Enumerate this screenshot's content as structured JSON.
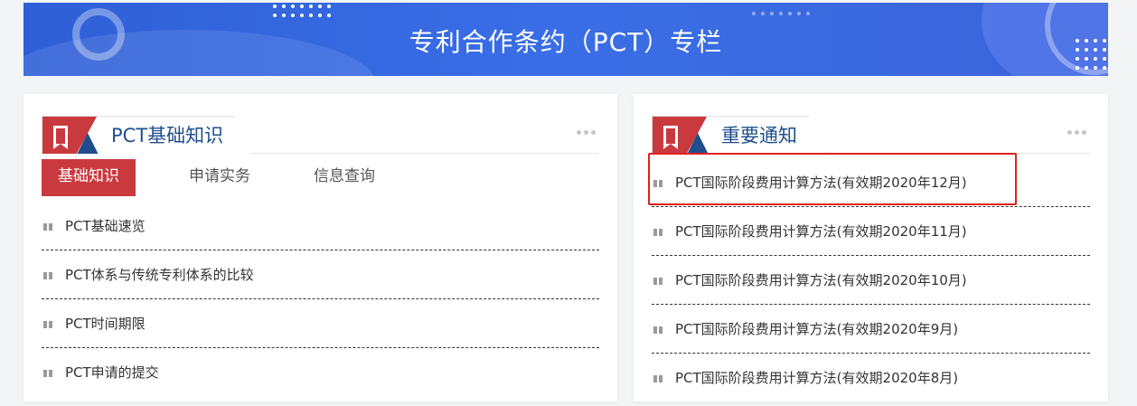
{
  "banner": {
    "title": "专利合作条约（PCT）专栏"
  },
  "left_panel": {
    "title": "PCT基础知识",
    "more_icon": "more-dots-icon",
    "tabs": [
      {
        "label": "基础知识",
        "active": true
      },
      {
        "label": "申请实务",
        "active": false
      },
      {
        "label": "信息查询",
        "active": false
      }
    ],
    "items": [
      {
        "label": "PCT基础速览"
      },
      {
        "label": "PCT体系与传统专利体系的比较"
      },
      {
        "label": "PCT时间期限"
      },
      {
        "label": "PCT申请的提交"
      }
    ]
  },
  "right_panel": {
    "title": "重要通知",
    "more_icon": "more-dots-icon",
    "items": [
      {
        "label": "PCT国际阶段费用计算方法(有效期2020年12月)",
        "highlighted": true
      },
      {
        "label": "PCT国际阶段费用计算方法(有效期2020年11月)"
      },
      {
        "label": "PCT国际阶段费用计算方法(有效期2020年10月)"
      },
      {
        "label": "PCT国际阶段费用计算方法(有效期2020年9月)"
      },
      {
        "label": "PCT国际阶段费用计算方法(有效期2020年8月)"
      }
    ]
  },
  "colors": {
    "banner": "#3a6ee6",
    "accent_red": "#c93a3f",
    "accent_blue": "#1f4e8c",
    "highlight": "#e0201c"
  }
}
